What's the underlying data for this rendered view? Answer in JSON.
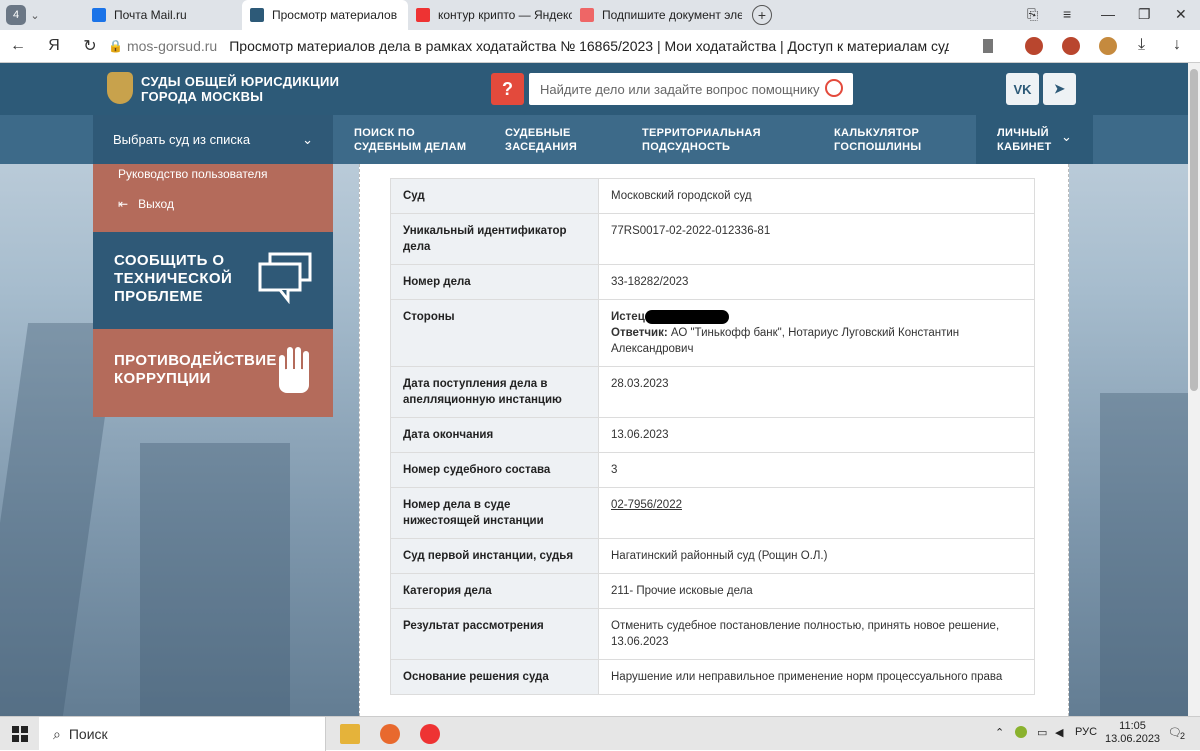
{
  "browser": {
    "tab_count": "4",
    "tabs": [
      {
        "title": "Почта Mail.ru",
        "color": "#1a73e8",
        "active": false
      },
      {
        "title": "Просмотр материалов",
        "color": "#2d5a78",
        "active": true,
        "close": "✕"
      },
      {
        "title": "контур крипто — Яндекс",
        "color": "#e33",
        "active": false
      },
      {
        "title": "Подпишите документ эле",
        "color": "#e66",
        "active": false
      }
    ],
    "new_tab": "+",
    "domain": "mos-gorsud.ru",
    "page_title": "Просмотр материалов дела в рамках ходатайства № 16865/2023 | Мои ходатайства | Доступ к материалам суд..."
  },
  "site": {
    "logo_line1": "СУДЫ ОБЩЕЙ ЮРИСДИКЦИИ",
    "logo_line2": "ГОРОДА МОСКВЫ",
    "help_label": "?",
    "search_placeholder": "Найдите дело или задайте вопрос помощнику",
    "vk_label": "VK",
    "tg_label": "➤",
    "court_select": "Выбрать суд из списка",
    "nav": [
      {
        "l1": "ПОИСК ПО",
        "l2": "СУДЕБНЫМ ДЕЛАМ"
      },
      {
        "l1": "СУДЕБНЫЕ",
        "l2": "ЗАСЕДАНИЯ"
      },
      {
        "l1": "ТЕРРИТОРИАЛЬНАЯ",
        "l2": "ПОДСУДНОСТЬ"
      },
      {
        "l1": "КАЛЬКУЛЯТОР",
        "l2": "ГОСПОШЛИНЫ"
      },
      {
        "l1": "ЛИЧНЫЙ",
        "l2": "КАБИНЕТ"
      }
    ],
    "side_guide": "Руководство пользователя",
    "side_exit": "Выход",
    "tile1": [
      "СООБЩИТЬ О",
      "ТЕХНИЧЕСКОЙ",
      "ПРОБЛЕМЕ"
    ],
    "tile2": [
      "ПРОТИВОДЕЙСТВИЕ",
      "КОРРУПЦИИ"
    ]
  },
  "case": {
    "rows": [
      {
        "label": "Суд",
        "value": "Московский городской суд"
      },
      {
        "label": "Уникальный идентификатор дела",
        "value": "77RS0017-02-2022-012336-81"
      },
      {
        "label": "Номер дела",
        "value": "33-18282/2023"
      },
      {
        "label": "Стороны",
        "value": ""
      },
      {
        "label": "Дата поступления дела в апелляционную инстанцию",
        "value": "28.03.2023"
      },
      {
        "label": "Дата окончания",
        "value": "13.06.2023"
      },
      {
        "label": "Номер судебного состава",
        "value": "3"
      },
      {
        "label": "Номер дела в суде нижестоящей инстанции",
        "value": "02-7956/2022"
      },
      {
        "label": "Суд первой инстанции, судья",
        "value": "Нагатинский районный суд (Рощин О.Л.)"
      },
      {
        "label": "Категория дела",
        "value": "211- Прочие исковые дела"
      },
      {
        "label": "Результат рассмотрения",
        "value": "Отменить судебное постановление полностью, принять новое решение, 13.06.2023"
      },
      {
        "label": "Основание решения суда",
        "value": "Нарушение или неправильное применение норм процессуального права"
      }
    ],
    "plaintiff_label": "Истец:",
    "defendant_label": "Ответчик:",
    "defendant_value": "АО \"Тинькофф банк\", Нотариус Луговский Константин Александрович"
  },
  "taskbar": {
    "search": "Поиск",
    "lang": "РУС",
    "time": "11:05",
    "date": "13.06.2023",
    "notif": "2"
  }
}
